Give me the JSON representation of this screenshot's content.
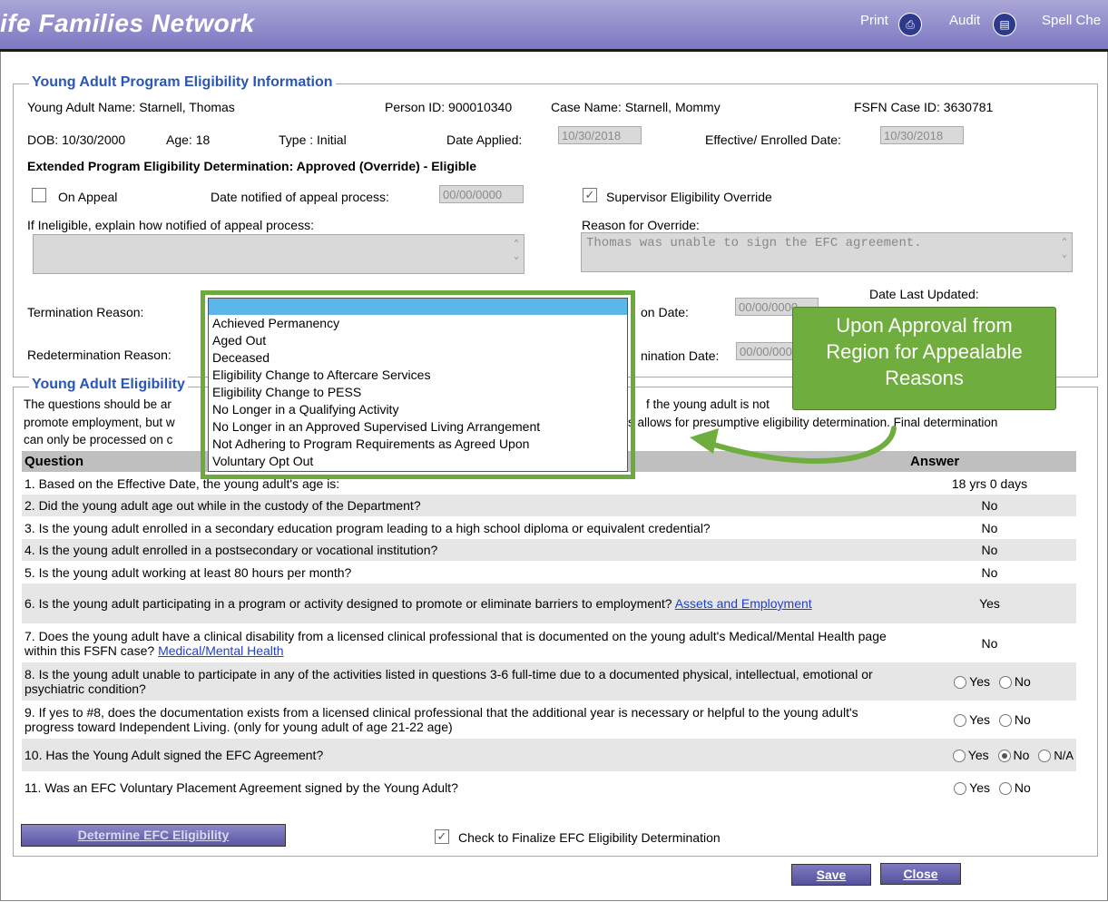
{
  "header": {
    "brand": "ife Families Network",
    "print_label": "Print",
    "audit_label": "Audit",
    "spell_label": "Spell Che"
  },
  "eligibility": {
    "legend": "Young Adult Program Eligibility Information",
    "name": "Young Adult Name: Starnell, Thomas",
    "person_id": "Person ID: 900010340",
    "case_name": "Case Name: Starnell, Mommy",
    "case_id": "FSFN Case ID: 3630781",
    "dob": "DOB: 10/30/2000",
    "age": "Age: 18",
    "type": "Type : Initial",
    "date_applied_label": "Date Applied:",
    "date_applied": "10/30/2018",
    "effective_label": "Effective/ Enrolled Date:",
    "effective": "10/30/2018",
    "determination": "Extended Program Eligibility Determination: Approved (Override) - Eligible",
    "on_appeal_label": "On Appeal",
    "date_notified_label": "Date notified of appeal process:",
    "date_notified": "00/00/0000",
    "supervisor_override_label": "Supervisor Eligibility Override",
    "ineligible_label": "If Ineligible, explain how notified of appeal process:",
    "override_reason_label": "Reason for Override:",
    "override_reason": "Thomas was unable to sign the EFC agreement.",
    "termination_reason_label": "Termination Reason:",
    "termination_date_label": "on Date:",
    "termination_date": "00/00/0000",
    "date_last_updated_label": "Date Last Updated:",
    "redetermination_reason_label": "Redetermination Reason:",
    "redetermination_date_label": "nination Date:",
    "redetermination_date": "00/00/0000"
  },
  "dropdown": {
    "options": [
      "Achieved Permanency",
      "Aged Out",
      "Deceased",
      "Eligibility Change to Aftercare Services",
      "Eligibility Change to PESS",
      "No Longer in a Qualifying Activity",
      "No Longer in an Approved Supervised Living Arrangement",
      "Not Adhering to Program Requirements as Agreed Upon",
      "Voluntary Opt Out"
    ]
  },
  "callout": {
    "line1": "Upon Approval from",
    "line2": "Region for Appealable",
    "line3": "Reasons"
  },
  "questions_section": {
    "legend": "Young Adult Eligibility",
    "desc1a": "The questions should be ar",
    "desc1b": "f the young adult is not",
    "desc2a": "promote employment, but w",
    "desc2b": "s allows for presumptive eligibility determination. Final determination",
    "desc3": "can only be processed on c",
    "col_question": "Question",
    "col_answer": "Answer",
    "q1": "1. Based on the Effective Date, the young adult's age is:",
    "a1": "18 yrs 0 days",
    "q2": "2. Did the young adult age out while in the custody of the Department?",
    "a2": "No",
    "q3": "3. Is the young adult enrolled in a secondary education program leading to a high school diploma or equivalent credential?",
    "a3": "No",
    "q4": "4. Is the young adult enrolled in a postsecondary or vocational institution?",
    "a4": "No",
    "q5": "5. Is the young adult working at least 80 hours per month?",
    "a5": "No",
    "q6": "6. Is the young adult participating in a program or activity designed to promote or eliminate barriers to employment?",
    "q6_link": "Assets and Employment",
    "a6": "Yes",
    "q7": "7. Does the young adult have a clinical disability from a licensed clinical professional that is documented on the young adult's Medical/Mental Health page within this FSFN case?",
    "q7_link": "Medical/Mental Health",
    "a7": "No",
    "q8": "8. Is the young adult unable to participate in any of the activities listed in questions 3-6 full-time due to a documented physical, intellectual, emotional or psychiatric condition?",
    "q9": "9. If yes to #8, does the documentation exists from a licensed clinical professional that the additional year is necessary or helpful to the young adult's progress toward Independent Living. (only for young adult of age 21-22 age)",
    "q10": "10. Has the Young Adult signed the EFC Agreement?",
    "q11": "11. Was an EFC Voluntary Placement Agreement signed by the Young Adult?",
    "yes": "Yes",
    "no": "No",
    "na": "N/A"
  },
  "footer": {
    "determine_label": "Determine EFC Eligibility",
    "finalize_label": "Check to Finalize EFC Eligibility Determination",
    "save_label": "Save",
    "close_label": "Close"
  }
}
